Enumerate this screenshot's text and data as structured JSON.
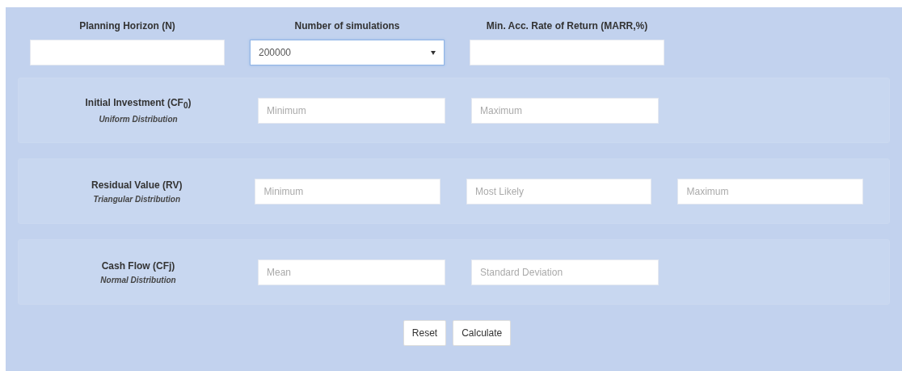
{
  "top_fields": [
    {
      "label": "Planning Horizon (N)",
      "kind": "input"
    },
    {
      "label": "Number of simulations",
      "kind": "select",
      "value": "200000"
    },
    {
      "label": "Min. Acc. Rate of Return (MARR,%)",
      "kind": "input"
    }
  ],
  "sections": [
    {
      "title": "Initial Investment (CF$_{0}$)",
      "subtitle": "Uniform Distribution",
      "fields": [
        {
          "placeholder": "Minimum"
        },
        {
          "placeholder": "Maximum"
        }
      ]
    },
    {
      "title": "Residual Value (RV)",
      "subtitle": "Triangular Distribution",
      "fields": [
        {
          "placeholder": "Minimum"
        },
        {
          "placeholder": "Most Likely"
        },
        {
          "placeholder": "Maximum"
        }
      ]
    },
    {
      "title": "Cash Flow (CFj)",
      "subtitle": "Normal Distribution",
      "fields": [
        {
          "placeholder": "Mean"
        },
        {
          "placeholder": "Standard Deviation"
        }
      ]
    }
  ],
  "buttons": [
    "Reset",
    "Calculate"
  ]
}
